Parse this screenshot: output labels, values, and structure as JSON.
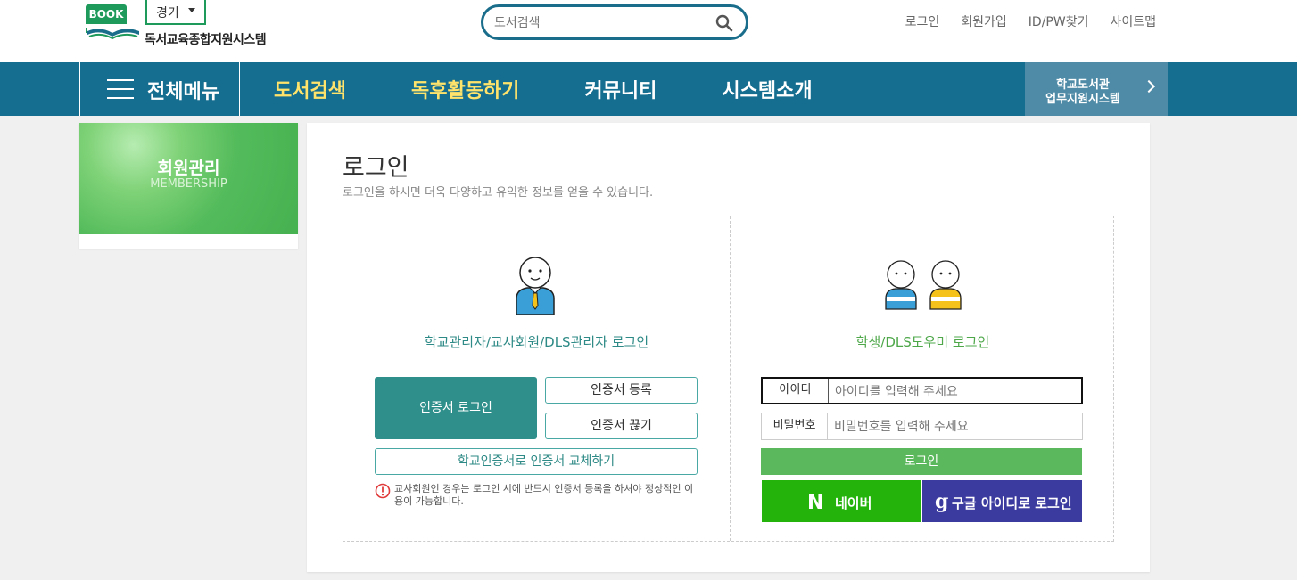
{
  "header": {
    "logo_badge": "BOOK",
    "site_name": "독서교육종합지원시스템",
    "region": "경기",
    "search_placeholder": "도서검색",
    "util_links": [
      "로그인",
      "회원가입",
      "ID/PW찾기",
      "사이트맵"
    ]
  },
  "nav": {
    "all_menu": "전체메뉴",
    "items": [
      "도서검색",
      "독후활동하기",
      "커뮤니티",
      "시스템소개"
    ],
    "school_line1": "학교도서관",
    "school_line2": "업무지원시스템"
  },
  "sidebar": {
    "title": "회원관리",
    "subtitle": "MEMBERSHIP"
  },
  "main": {
    "title": "로그인",
    "description": "로그인을 하시면 더욱 다양하고 유익한 정보를 얻을 수 있습니다.",
    "teacher": {
      "title": "학교관리자/교사회원/DLS관리자 로그인",
      "cert_login": "인증서 로그인",
      "cert_register": "인증서 등록",
      "cert_copy": "인증서 끊기",
      "cert_swap": "학교인증서로 인증서 교체하기",
      "notice": "교사회원인 경우는 로그인 시에 반드시 인증서 등록을 하셔야 정상적인 이용이 가능합니다."
    },
    "student": {
      "title": "학생/DLS도우미 로그인",
      "id_label": "아이디",
      "id_placeholder": "아이디를 입력해 주세요",
      "pw_label": "비밀번호",
      "pw_placeholder": "비밀번호를 입력해 주세요",
      "login_button": "로그인",
      "naver_logo": "N",
      "naver_label": "네이버",
      "google_logo": "g",
      "google_label": "구글 아이디로 로그인"
    }
  },
  "colors": {
    "nav_bg": "#156d8f",
    "nav_highlight": "#ffe36b",
    "teal": "#2e8f8b",
    "green": "#5cb85c",
    "naver": "#23b30b",
    "google": "#3b3a9e"
  }
}
